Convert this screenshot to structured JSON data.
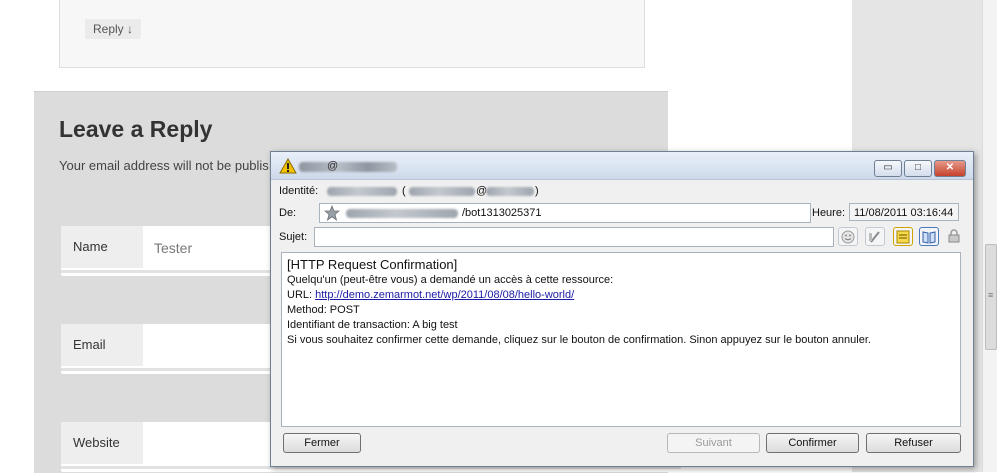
{
  "page": {
    "reply_button": "Reply ↓",
    "reply_title": "Leave a Reply",
    "reply_note": "Your email address will not be publis",
    "fields": [
      {
        "label": "Name",
        "value": "Tester"
      },
      {
        "label": "Email",
        "value": ""
      },
      {
        "label": "Website",
        "value": ""
      }
    ]
  },
  "window": {
    "title_at": "@",
    "identite_label": "Identité:",
    "identite_paren_open": "(",
    "identite_at": "@",
    "identite_paren_close": ")",
    "de_label": "De:",
    "de_value": "/bot1313025371",
    "heure_label": "Heure:",
    "heure_value": "11/08/2011 03:16:44",
    "sujet_label": "Sujet:",
    "sujet_value": "",
    "body": {
      "line1": "[HTTP Request Confirmation]",
      "line2": "Quelqu'un (peut-être vous) a demandé un accès à cette ressource:",
      "url_prefix": "URL: ",
      "url": "http://demo.zemarmot.net/wp/2011/08/08/hello-world/",
      "method": "Method: POST",
      "transaction": "Identifiant de transaction: A big test",
      "instructions": "Si vous souhaitez confirmer cette demande, cliquez sur le bouton de confirmation. Sinon appuyez sur le bouton annuler."
    },
    "buttons": {
      "fermer": "Fermer",
      "suivant": "Suivant",
      "confirmer": "Confirmer",
      "refuser": "Refuser"
    },
    "icons": [
      "warning-icon",
      "star-icon",
      "smiley-icon",
      "pen-icon",
      "note-icon",
      "book-icon",
      "lock-icon"
    ],
    "colors": {
      "link": "#1a1aa6",
      "close_button": "#c4412c",
      "warning": "#f2c200"
    }
  }
}
